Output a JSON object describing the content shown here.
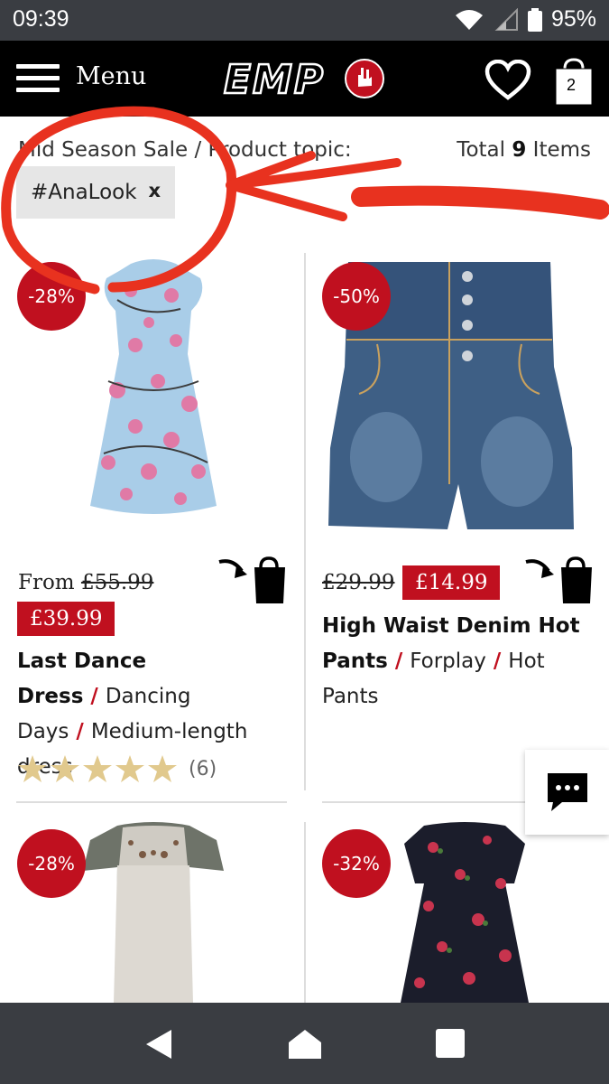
{
  "status": {
    "time": "09:39",
    "battery": "95%"
  },
  "topbar": {
    "menu_label": "Menu",
    "logo_text": "EMP",
    "cart_count": "2"
  },
  "filter": {
    "breadcrumb": "Mid Season Sale / Product topic:",
    "total_prefix": "Total",
    "total_count": "9",
    "total_suffix": "Items",
    "chip_label": "#AnaLook",
    "chip_close": "x"
  },
  "products": [
    {
      "badge": "-28%",
      "price_prefix": "From",
      "old_price": "£55.99",
      "sale_price": "£39.99",
      "name": "Last Dance Dress",
      "brand": "Dancing Days",
      "type": "Medium-length dress",
      "rating_stars": 5,
      "reviews": "(6)"
    },
    {
      "badge": "-50%",
      "old_price": "£29.99",
      "sale_price": "£14.99",
      "name": "High Waist Denim Hot Pants",
      "brand": "Forplay",
      "type": "Hot Pants"
    },
    {
      "badge": "-28%"
    },
    {
      "badge": "-32%"
    }
  ],
  "colors": {
    "accent": "#c0101f",
    "topbar": "#000000",
    "statusbar": "#3a3d42",
    "annotation": "#e8321f",
    "star": "#e1c98d"
  },
  "icons": [
    "wifi-icon",
    "signal-icon",
    "battery-icon",
    "hamburger-icon",
    "heart-icon",
    "shopping-bag-icon",
    "add-to-cart-icon",
    "star-icon",
    "chat-icon",
    "back-icon",
    "home-icon",
    "recents-icon"
  ]
}
